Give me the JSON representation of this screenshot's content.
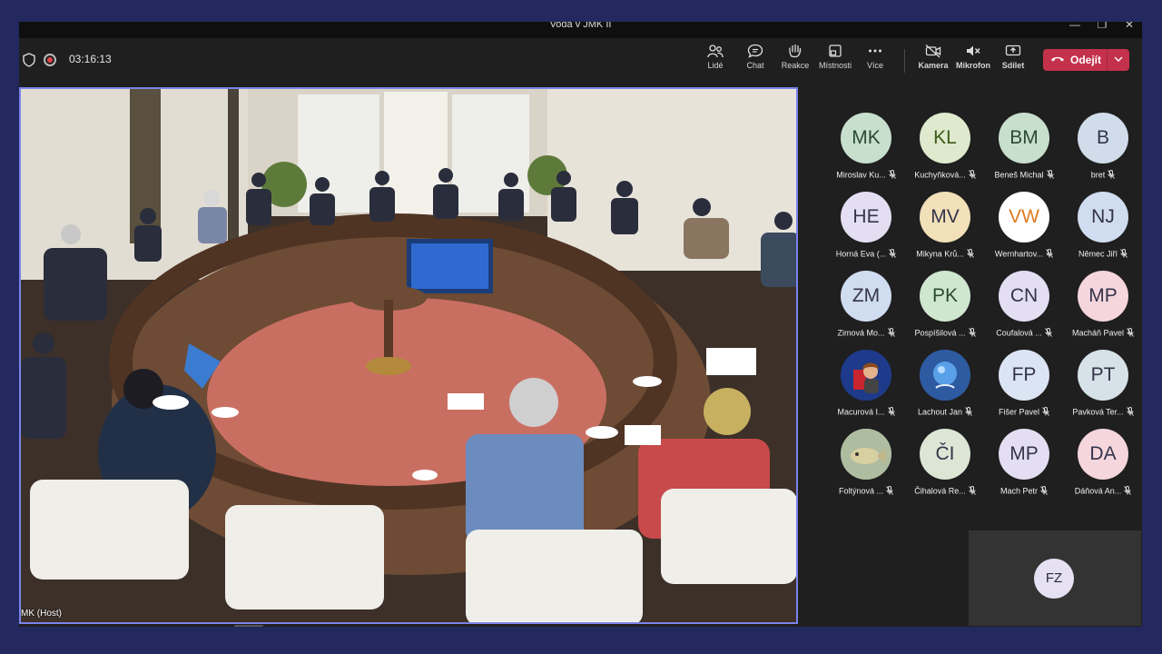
{
  "window": {
    "title": "Voda v JMK II",
    "minimize": "—",
    "maximize": "❐",
    "close": "✕"
  },
  "toolbar": {
    "timer": "03:16:13",
    "people": "Lidé",
    "chat": "Chat",
    "reactions": "Reakce",
    "rooms": "Místnosti",
    "more": "Více",
    "camera": "Kamera",
    "microphone": "Mikrofon",
    "share": "Sdílet",
    "leave": "Odejít"
  },
  "stage": {
    "name": "MK (Host)"
  },
  "participants": [
    {
      "initials": "MK",
      "name": "Miroslav Ku...",
      "color": "#c8dfce"
    },
    {
      "initials": "KL",
      "name": "Kuchyňková...",
      "color": "#dfe9cd"
    },
    {
      "initials": "BM",
      "name": "Beneš Michal",
      "color": "#c8dfce"
    },
    {
      "initials": "B",
      "name": "bret",
      "color": "#d0dcea"
    },
    {
      "initials": "HE",
      "name": "Horná Eva (...",
      "color": "#e3def2"
    },
    {
      "initials": "MV",
      "name": "Mikyna Krů...",
      "color": "#f1e0b8"
    },
    {
      "initials": "VW",
      "name": "Wernhartov...",
      "color": "#ffffff"
    },
    {
      "initials": "NJ",
      "name": "Němec Jiří",
      "color": "#d0dcf0"
    },
    {
      "initials": "ZM",
      "name": "Zimová Mo...",
      "color": "#d0dcf0"
    },
    {
      "initials": "PK",
      "name": "Pospíšilová ...",
      "color": "#cfe6cf"
    },
    {
      "initials": "CN",
      "name": "Coufalová ...",
      "color": "#e3def2"
    },
    {
      "initials": "MP",
      "name": "Macháň Pavel",
      "color": "#f5d6dd"
    },
    {
      "initials": "",
      "name": "Macurová I...",
      "color": "#1e3a8a"
    },
    {
      "initials": "",
      "name": "Lachout Jan",
      "color": "#2a5ea8"
    },
    {
      "initials": "FP",
      "name": "Fišer Pavel",
      "color": "#dbe4f3"
    },
    {
      "initials": "PT",
      "name": "Pavková Ter...",
      "color": "#d6e2e8"
    },
    {
      "initials": "",
      "name": "Foltýnová ...",
      "color": "#b7c7a8"
    },
    {
      "initials": "ČI",
      "name": "Čihalová Re...",
      "color": "#dde6d5"
    },
    {
      "initials": "MP",
      "name": "Mach Petr",
      "color": "#e3def2"
    },
    {
      "initials": "DA",
      "name": "Dáňová An...",
      "color": "#f5d6dd"
    }
  ],
  "self_tile": {
    "initials": "FZ"
  }
}
